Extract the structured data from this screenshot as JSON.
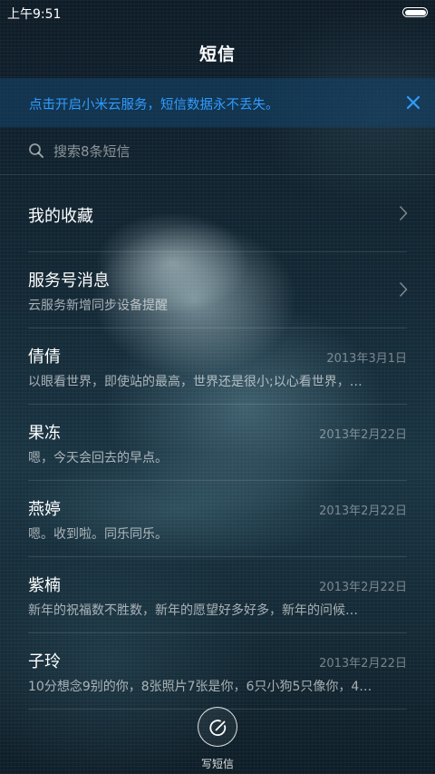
{
  "status_bar": {
    "time": "上午9:51"
  },
  "header": {
    "title": "短信"
  },
  "banner": {
    "text": "点击开启小米云服务，短信数据永不丢失。"
  },
  "search": {
    "placeholder": "搜索8条短信"
  },
  "folders": [
    {
      "name": "我的收藏"
    },
    {
      "name": "服务号消息",
      "subtitle": "云服务新增同步设备提醒"
    }
  ],
  "conversations": [
    {
      "name": "倩倩",
      "date": "2013年3月1日",
      "preview": "以眼看世界，即使站的最高，世界还是很小;以心看世界，…"
    },
    {
      "name": "果冻",
      "date": "2013年2月22日",
      "preview": "嗯，今天会回去的早点。"
    },
    {
      "name": "燕婷",
      "date": "2013年2月22日",
      "preview": "嗯。收到啦。同乐同乐。"
    },
    {
      "name": "紫楠",
      "date": "2013年2月22日",
      "preview": "新年的祝福数不胜数，新年的愿望好多好多，新年的问候…"
    },
    {
      "name": "子玲",
      "date": "2013年2月22日",
      "preview": "10分想念9别的你，8张照片7张是你，6只小狗5只像你，4…"
    }
  ],
  "compose": {
    "label": "写短信"
  },
  "colors": {
    "accent": "#2f9cff",
    "banner_bg": "#14466e"
  }
}
